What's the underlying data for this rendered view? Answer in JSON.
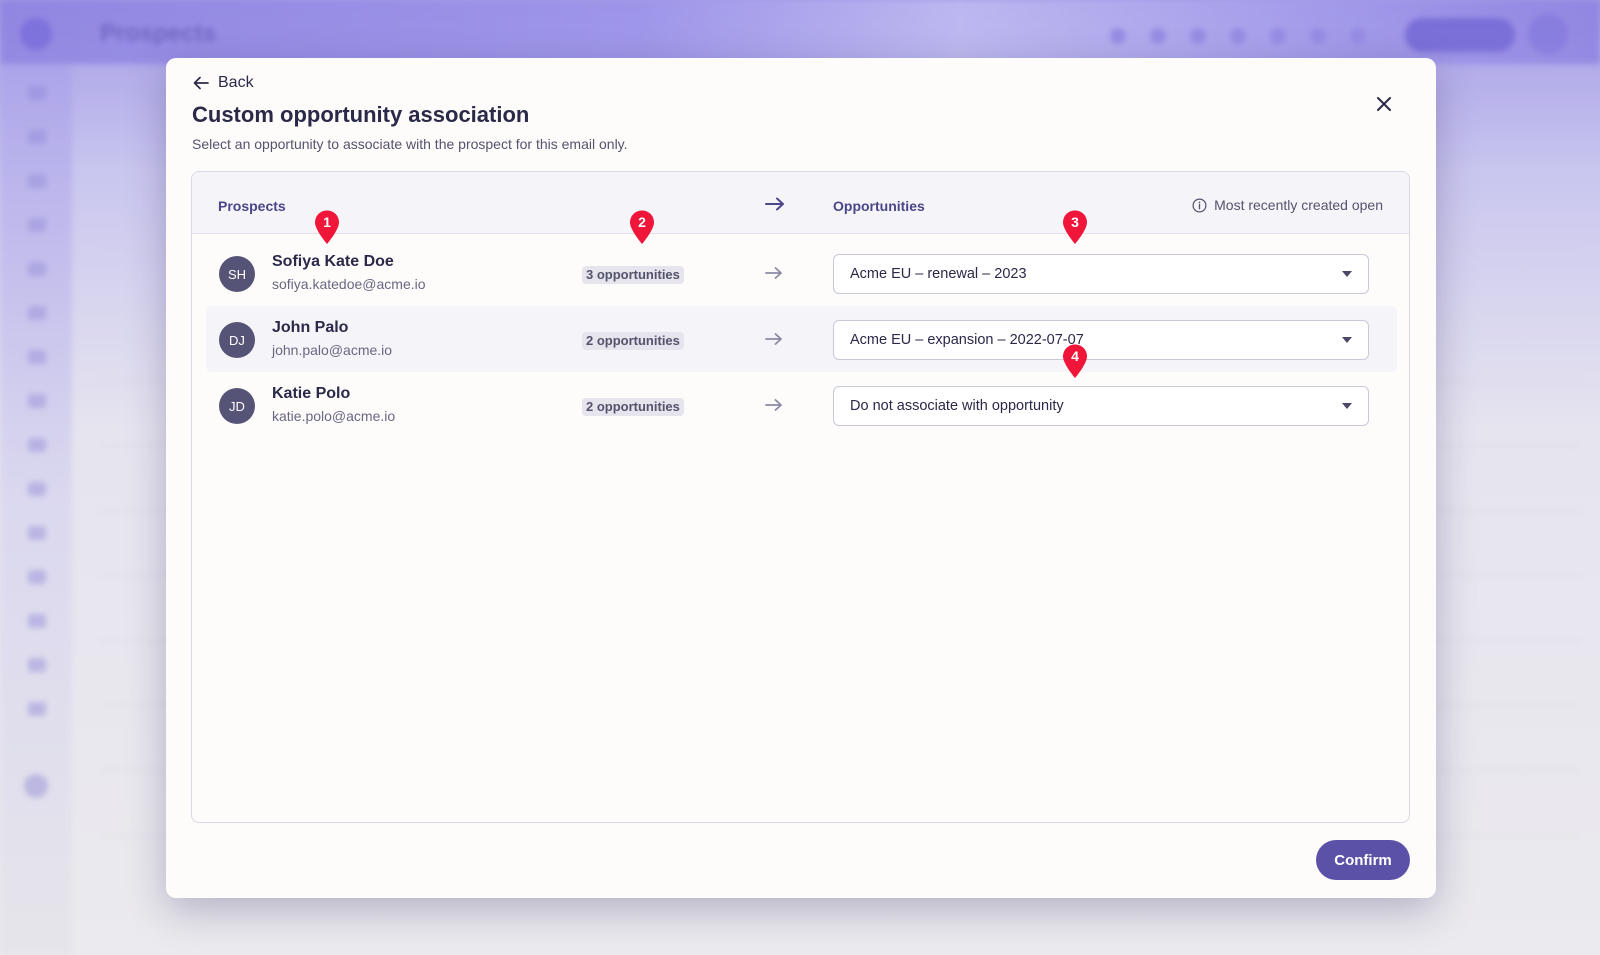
{
  "background": {
    "page_title": "Prospects"
  },
  "modal": {
    "back_label": "Back",
    "title": "Custom opportunity association",
    "subtitle": "Select an opportunity to associate with the prospect for this email only.",
    "close_icon": "close-icon",
    "columns": {
      "prospects": "Prospects",
      "opportunities": "Opportunities"
    },
    "info_note": "Most recently created open",
    "rows": [
      {
        "initials": "SH",
        "name": "Sofiya Kate Doe",
        "email": "sofiya.katedoe@acme.io",
        "opportunity_count": "3 opportunities",
        "selected_opportunity": "Acme EU  – renewal – 2023"
      },
      {
        "initials": "DJ",
        "name": "John Palo",
        "email": "john.palo@acme.io",
        "opportunity_count": "2 opportunities",
        "selected_opportunity": "Acme EU – expansion – 2022-07-07"
      },
      {
        "initials": "JD",
        "name": "Katie Polo",
        "email": "katie.polo@acme.io",
        "opportunity_count": "2 opportunities",
        "selected_opportunity": "Do not associate with opportunity"
      }
    ],
    "confirm_label": "Confirm"
  },
  "markers": [
    "1",
    "2",
    "3",
    "4"
  ],
  "colors": {
    "accent": "#5b52a8",
    "marker": "#f0163a",
    "header_text": "#4a4688"
  }
}
